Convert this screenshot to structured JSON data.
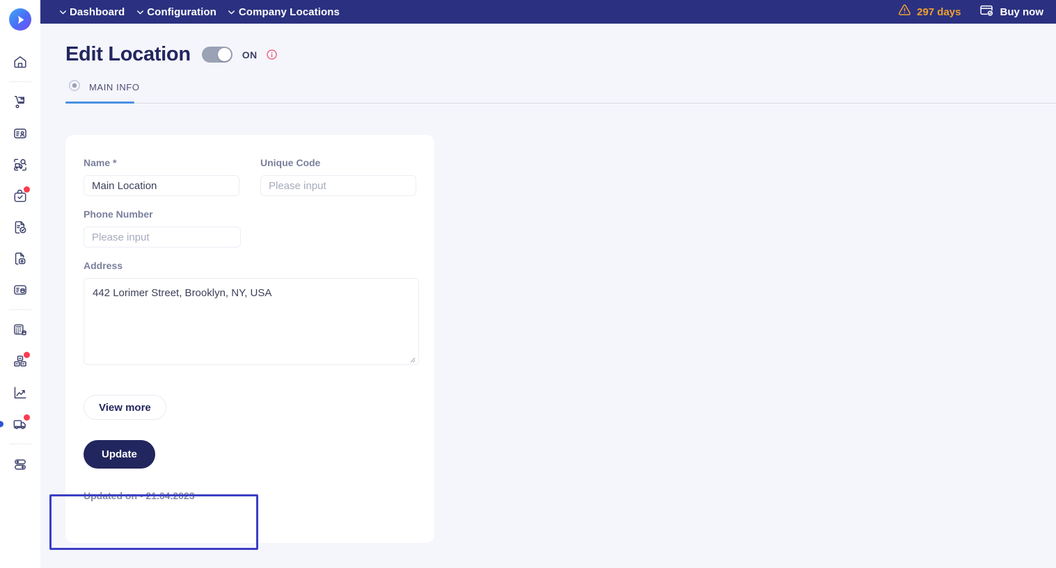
{
  "brand": {
    "logo_name": "app-logo",
    "accent": "#2b3180",
    "tab_accent": "#4a90e2"
  },
  "topbar": {
    "breadcrumbs": [
      {
        "label": "Dashboard"
      },
      {
        "label": "Configuration"
      },
      {
        "label": "Company Locations"
      }
    ],
    "trial": {
      "label": "297 days",
      "icon": "warning-triangle-icon",
      "color": "#f0a030"
    },
    "buy": {
      "label": "Buy now",
      "icon": "credit-card-check-icon"
    }
  },
  "sidebar": {
    "items": [
      {
        "name": "home",
        "icon": "home-icon",
        "badge": false,
        "active": false
      },
      {
        "name": "procurement",
        "icon": "hand-truck-icon",
        "badge": false,
        "active": false
      },
      {
        "name": "suppliers",
        "icon": "contact-card-icon",
        "badge": false,
        "active": false
      },
      {
        "name": "supplier-search",
        "icon": "truck-search-icon",
        "badge": false,
        "active": false
      },
      {
        "name": "tasks",
        "icon": "bag-check-icon",
        "badge": true,
        "active": false
      },
      {
        "name": "contracts",
        "icon": "document-check-icon",
        "badge": false,
        "active": false
      },
      {
        "name": "secure-documents",
        "icon": "document-lock-icon",
        "badge": false,
        "active": false
      },
      {
        "name": "records",
        "icon": "card-database-icon",
        "badge": false,
        "active": false
      },
      {
        "name": "accounting",
        "icon": "calculator-database-icon",
        "badge": false,
        "active": false
      },
      {
        "name": "inventory",
        "icon": "boxes-icon",
        "badge": true,
        "active": false
      },
      {
        "name": "analytics",
        "icon": "trend-chart-icon",
        "badge": false,
        "active": false
      },
      {
        "name": "logistics",
        "icon": "delivery-truck-icon",
        "badge": true,
        "active": true
      },
      {
        "name": "settings-toggles",
        "icon": "toggles-icon",
        "badge": false,
        "active": false
      }
    ]
  },
  "page": {
    "title": "Edit Location",
    "status_toggle": {
      "state_label": "ON",
      "enabled": true
    },
    "info_icon": "info-circle-icon",
    "tabs": [
      {
        "label": "MAIN INFO",
        "icon": "radio-selected-icon",
        "active": true
      }
    ]
  },
  "form": {
    "name": {
      "label": "Name *",
      "value": "Main Location",
      "placeholder": "Please input"
    },
    "unique_code": {
      "label": "Unique Code",
      "value": "",
      "placeholder": "Please input"
    },
    "phone": {
      "label": "Phone Number",
      "value": "",
      "placeholder": "Please input"
    },
    "address": {
      "label": "Address",
      "value": "442 Lorimer Street, Brooklyn, NY, USA",
      "placeholder": "Please input"
    },
    "view_more_label": "View more",
    "update_label": "Update",
    "updated_on": "Updated on - 21.04.2023"
  },
  "annotation": {
    "color": "#3b3fc4",
    "target": "updated-on-text"
  }
}
